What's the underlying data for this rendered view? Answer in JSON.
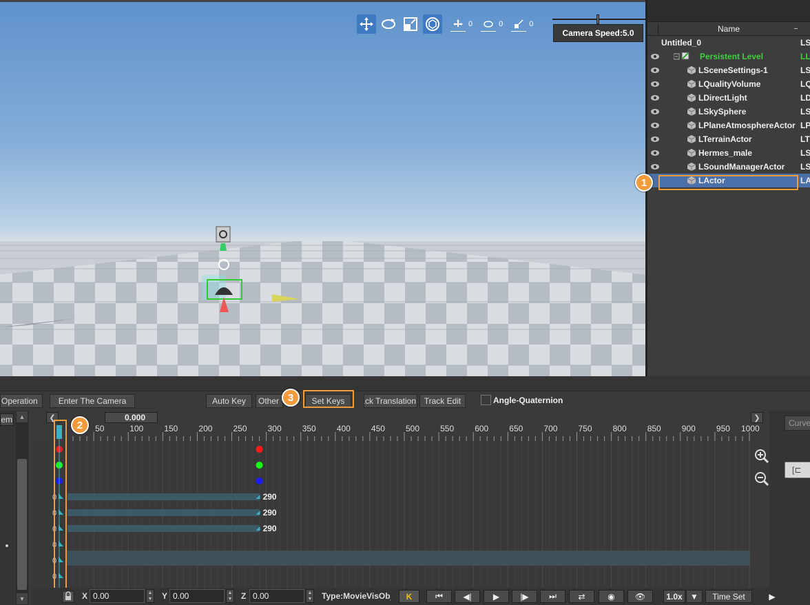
{
  "viewport": {
    "camera_speed_label": "Camera Speed:5.0",
    "tools": [
      "move-tool",
      "rotate-tool",
      "scale-tool",
      "world-local-tool"
    ],
    "snap_values": {
      "translate": "0",
      "rotate": "0",
      "scale": "0"
    }
  },
  "outliner": {
    "header": "Name",
    "items": [
      {
        "label": "Untitled_0",
        "type": "LS",
        "indent": 0,
        "eye": false,
        "icon": "none"
      },
      {
        "label": "Persistent Level",
        "type": "LL",
        "indent": 1,
        "eye": true,
        "icon": "level-icon",
        "style": "green"
      },
      {
        "label": "LSceneSettings-1",
        "type": "LS",
        "indent": 2,
        "eye": true,
        "icon": "cube-icon"
      },
      {
        "label": "LQualityVolume",
        "type": "LQ",
        "indent": 2,
        "eye": true,
        "icon": "cube-icon"
      },
      {
        "label": "LDirectLight",
        "type": "LD",
        "indent": 2,
        "eye": true,
        "icon": "cube-icon"
      },
      {
        "label": "LSkySphere",
        "type": "LS",
        "indent": 2,
        "eye": true,
        "icon": "cube-icon"
      },
      {
        "label": "LPlaneAtmosphereActor",
        "type": "LP",
        "indent": 2,
        "eye": true,
        "icon": "cube-icon"
      },
      {
        "label": "LTerrainActor",
        "type": "LT",
        "indent": 2,
        "eye": true,
        "icon": "cube-icon"
      },
      {
        "label": "Hermes_male",
        "type": "LS",
        "indent": 2,
        "eye": true,
        "icon": "cube-icon"
      },
      {
        "label": "LSoundManagerActor",
        "type": "LS",
        "indent": 2,
        "eye": true,
        "icon": "cube-icon"
      },
      {
        "label": "LActor",
        "type": "LA",
        "indent": 2,
        "eye": false,
        "icon": "cube-icon",
        "style": "selected"
      }
    ]
  },
  "badges": [
    "1",
    "2",
    "3"
  ],
  "toolbar": {
    "operation": "Operation",
    "enter_camera": "Enter The Camera",
    "auto_key": "Auto Key",
    "other": "Other",
    "set_keys": "Set Keys",
    "track_translation": "Track Translation",
    "track_edit": "Track Edit",
    "angle_quaternion": "Angle-Quaternion"
  },
  "left": {
    "item_label": "Item"
  },
  "timeline": {
    "current_frame": "0.000",
    "ruler_ticks": [
      "50",
      "100",
      "150",
      "200",
      "250",
      "300",
      "350",
      "400",
      "450",
      "500",
      "550",
      "600",
      "650",
      "700",
      "750",
      "800",
      "850",
      "900",
      "950",
      "1000"
    ],
    "key_end_labels": [
      "290",
      "290",
      "290"
    ],
    "row_start_values": [
      "0",
      "0",
      "0",
      "0",
      "0",
      "0"
    ]
  },
  "bottom": {
    "x_label": "X",
    "x_value": "0.00",
    "y_label": "Y",
    "y_value": "0.00",
    "z_label": "Z",
    "z_value": "0.00",
    "type_text": "Type:MovieVisObject",
    "speed": "1.0x",
    "time_set": "Time Set"
  },
  "right": {
    "curve_tab": "Curve"
  },
  "colors": {
    "accent": "#f29b3d",
    "selection": "#4b6fa8",
    "level_green": "#3dd23d",
    "key_red": "#ff1a1a",
    "key_green": "#1aff1a",
    "key_blue": "#1a1aff",
    "track_bar": "#3c5a66"
  }
}
